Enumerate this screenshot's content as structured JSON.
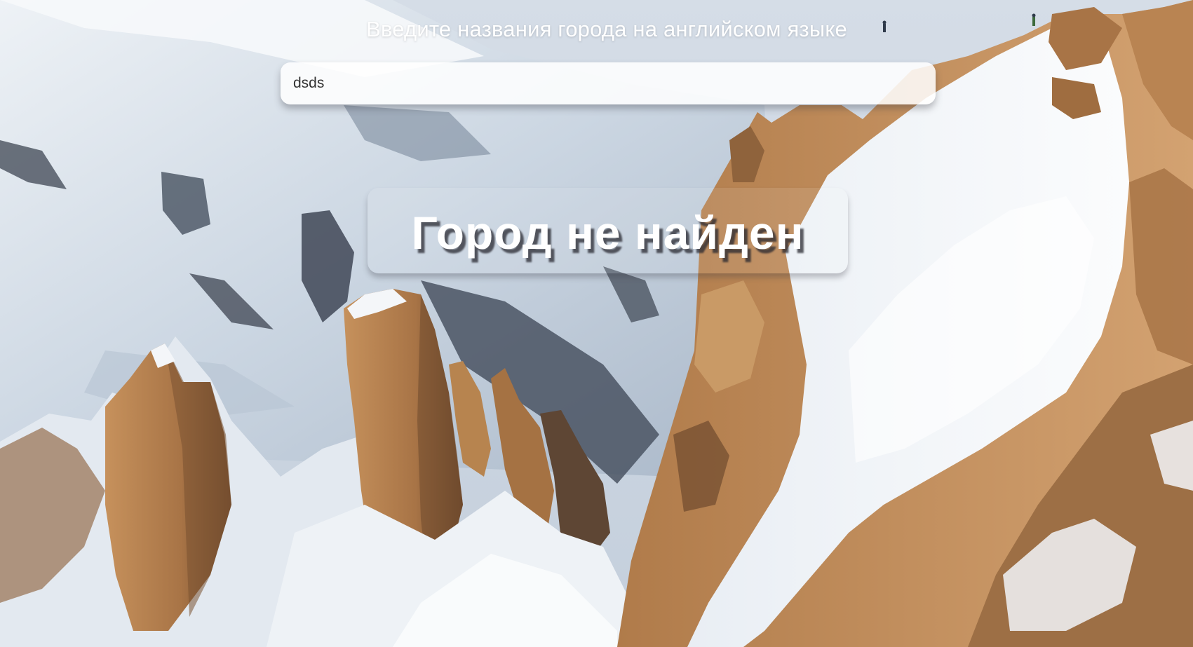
{
  "app": {
    "prompt_text": "Введите названия города на английском языке",
    "search": {
      "value": "dsds",
      "placeholder": ""
    },
    "result": {
      "message": "Город не найден"
    }
  },
  "background": {
    "scene": "snowy-mountain-peaks-photo",
    "colors": {
      "sky": "#cfd8e3",
      "snow": "#f4f6f9",
      "shadow_snow": "#aebccd",
      "rock_dark": "#3b4251",
      "rock_warm": "#b98452",
      "rock_warm_dark": "#7a5232"
    }
  }
}
